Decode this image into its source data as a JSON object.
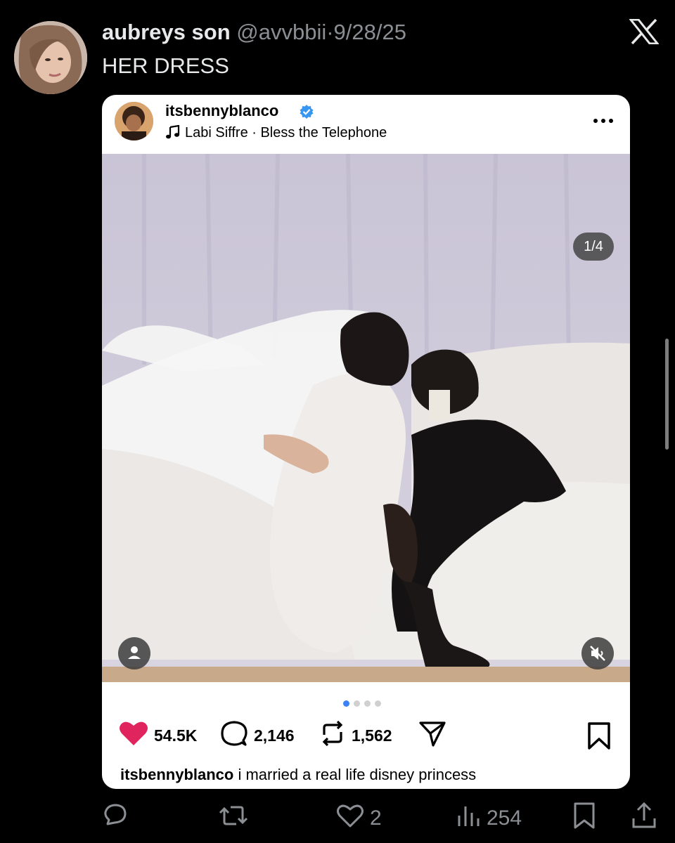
{
  "tweet": {
    "author_name": "aubreys son",
    "author_handle": "@avvbbii",
    "separator": "·",
    "date": "9/28/25",
    "text": "HER DRESS",
    "brand_icon": "x-logo-icon"
  },
  "embedded_post": {
    "username": "itsbennyblanco",
    "verified": true,
    "song": "Labi Siffre · Bless the Telephone",
    "photo_counter": "1/4",
    "likes": "54.5K",
    "comments": "2,146",
    "reposts": "1,562",
    "caption_user": "itsbennyblanco",
    "caption_text": "i married a real life disney princess",
    "carousel_position": 1,
    "carousel_count": 4,
    "accent_color": "#3b82f6",
    "like_color": "#e0245e"
  },
  "action_bar": {
    "reply_count": "",
    "retweet_count": "",
    "like_count": "2",
    "view_count": "254",
    "icons": [
      "reply-icon",
      "retweet-icon",
      "like-icon",
      "views-icon",
      "bookmark-icon",
      "share-icon"
    ]
  }
}
